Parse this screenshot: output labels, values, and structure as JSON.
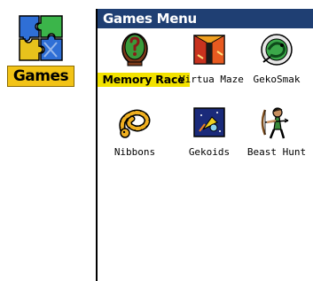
{
  "side_launcher": {
    "label": "Games",
    "icon": "puzzle-icon",
    "label_color": "#f2c316"
  },
  "window": {
    "title": "Games Menu",
    "title_bar_color": "#1f3f73"
  },
  "games": [
    {
      "label": "Memory Race",
      "icon": "memory-race-icon",
      "selected": true
    },
    {
      "label": "Virtua Maze",
      "icon": "virtua-maze-icon",
      "selected": false
    },
    {
      "label": "GekoSmak",
      "icon": "gekosmak-icon",
      "selected": false
    },
    {
      "label": "Nibbons",
      "icon": "nibbons-icon",
      "selected": false
    },
    {
      "label": "Gekoids",
      "icon": "gekoids-icon",
      "selected": false
    },
    {
      "label": "Beast Hunt",
      "icon": "beast-hunt-icon",
      "selected": false
    }
  ],
  "colors": {
    "selection_highlight": "#f2e200"
  }
}
